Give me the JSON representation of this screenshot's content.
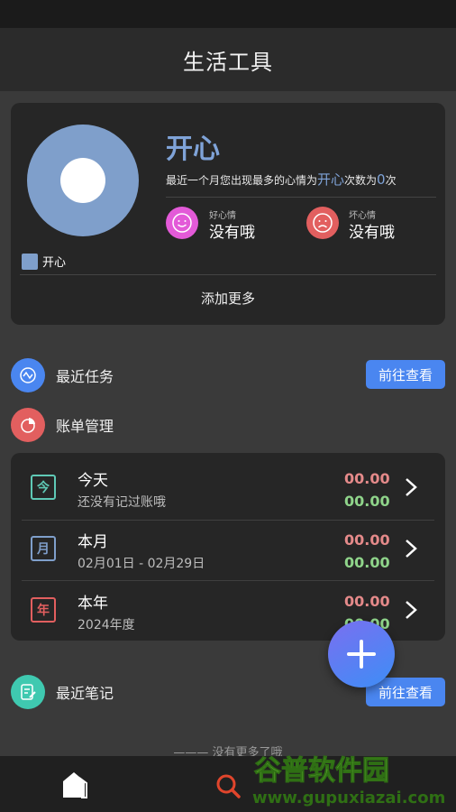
{
  "header": {
    "title": "生活工具"
  },
  "mood": {
    "title": "开心",
    "summary_prefix": "最近一个月您出现最多的心情为",
    "summary_mood": "开心",
    "summary_mid": "次数为",
    "summary_count": "0",
    "summary_suffix": "次",
    "legend_label": "开心",
    "good_caption": "好心情",
    "good_value": "没有哦",
    "bad_caption": "坏心情",
    "bad_value": "没有哦",
    "add_more": "添加更多",
    "chart_color": "#7f9fcb"
  },
  "tasks": {
    "label": "最近任务",
    "button": "前往查看"
  },
  "bills": {
    "label": "账单管理",
    "items": [
      {
        "badge": "今",
        "title": "今天",
        "subtitle": "还没有记过账哦",
        "expense": "00.00",
        "income": "00.00",
        "badge_color": "#5fc9b6"
      },
      {
        "badge": "月",
        "title": "本月",
        "subtitle": "02月01日 - 02月29日",
        "expense": "00.00",
        "income": "00.00",
        "badge_color": "#7f9fcb"
      },
      {
        "badge": "年",
        "title": "本年",
        "subtitle": "2024年度",
        "expense": "00.00",
        "income": "00.00",
        "badge_color": "#e25f5f"
      }
    ]
  },
  "notes": {
    "label": "最近笔记",
    "button": "前往查看"
  },
  "footer": {
    "no_more": "——— 没有更多了哦"
  },
  "watermark": {
    "text1": "谷普软件园",
    "text2": "www.gupuxiazai.com"
  },
  "colors": {
    "accent": "#4a86f0",
    "expense": "#e58a8a",
    "income": "#8fd48a"
  }
}
